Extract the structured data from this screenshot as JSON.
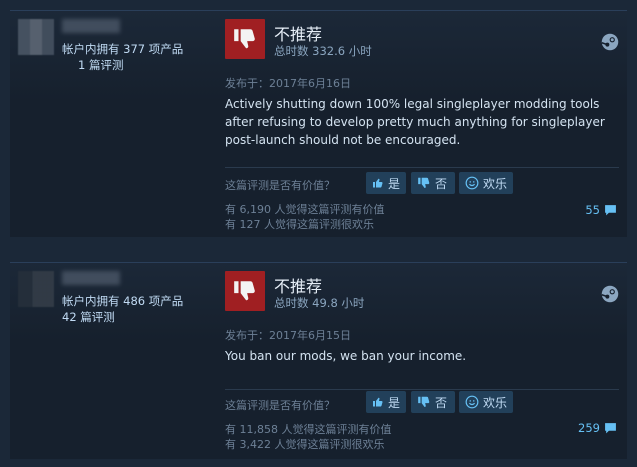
{
  "reviews": [
    {
      "owned_text": "帐户内拥有 377 项产品",
      "review_count_text": "1 篇评测",
      "verdict": "不推荐",
      "hours": "总时数 332.6 小时",
      "posted": "发布于：2017年6月16日",
      "body": "Actively shutting down 100% legal singleplayer modding tools after refusing to develop pretty much anything for singleplayer post-launch should not be encouraged.",
      "helpful_question": "这篇评测是否有价值？",
      "yes_label": "是",
      "no_label": "否",
      "funny_label": "欢乐",
      "helpful_stat": "有 6,190 人觉得这篇评测有价值",
      "funny_stat": "有 127 人觉得这篇评测很欢乐",
      "comments": "55"
    },
    {
      "owned_text": "帐户内拥有 486 项产品",
      "review_count_text": "42 篇评测",
      "verdict": "不推荐",
      "hours": "总时数 49.8 小时",
      "posted": "发布于：2017年6月15日",
      "body": "You ban our mods, we ban your income.",
      "helpful_question": "这篇评测是否有价值？",
      "yes_label": "是",
      "no_label": "否",
      "funny_label": "欢乐",
      "helpful_stat": "有 11,858 人觉得这篇评测有价值",
      "funny_stat": "有 3,422 人觉得这篇评测很欢乐",
      "comments": "259"
    }
  ],
  "icons": [
    "thumbs-down-icon",
    "steam-icon",
    "thumbs-up-icon",
    "smiley-icon",
    "comment-icon"
  ],
  "colors": {
    "thumb_bg": "#a01f22",
    "link": "#66c0f4",
    "panel": "#16202d"
  }
}
